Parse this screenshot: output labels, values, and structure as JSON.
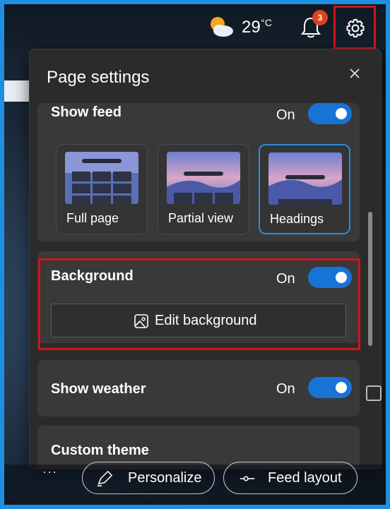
{
  "topbar": {
    "weather_icon": "partly-cloudy-icon",
    "temperature": "29",
    "temperature_unit": "°C",
    "notification_count": "3"
  },
  "panel": {
    "title": "Page settings",
    "show_feed": {
      "label": "Show feed",
      "state": "On",
      "options": [
        {
          "label": "Full page",
          "selected": false
        },
        {
          "label": "Partial view",
          "selected": false
        },
        {
          "label": "Headings",
          "selected": true
        }
      ]
    },
    "background": {
      "label": "Background",
      "state": "On",
      "edit_button": "Edit background"
    },
    "show_weather": {
      "label": "Show weather",
      "state": "On"
    },
    "custom_theme": {
      "label": "Custom theme"
    }
  },
  "bottom": {
    "more": "···",
    "personalize": "Personalize",
    "feed_layout": "Feed layout"
  },
  "colors": {
    "accent": "#1773d6",
    "highlight": "#d0141b",
    "panel_bg": "#2b2b2b",
    "card_bg": "#393939",
    "badge": "#d9431e",
    "frame_border": "#1f8fe0"
  }
}
